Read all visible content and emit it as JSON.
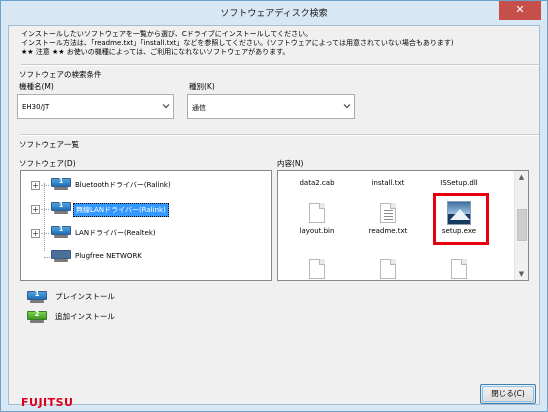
{
  "window": {
    "title": "ソフトウェアディスク検索",
    "close_glyph": "✕"
  },
  "instructions": [
    "インストールしたいソフトウェアを一覧から選び、Cドライブにインストールしてください。",
    "インストール方法は、「readme.txt」「install.txt」などを参照してください。(ソフトウェアによっては用意されていない場合もあります)",
    "★★ 注意 ★★ お使いの機種によっては、ご利用になれないソフトウェアがあります。"
  ],
  "search": {
    "section_label": "ソフトウェアの検索条件",
    "model_label": "機種名(M)",
    "model_value": "EH30/JT",
    "category_label": "種別(K)",
    "category_value": "通信"
  },
  "software_list": {
    "section_label": "ソフトウェア一覧",
    "software_label": "ソフトウェア(D)",
    "contents_label": "内容(N)",
    "items": [
      {
        "label": "Bluetoothドライバー(Ralink)",
        "num": "1",
        "selected": false
      },
      {
        "label": "無線LANドライバー(Ralink)",
        "num": "1",
        "selected": true
      },
      {
        "label": "LANドライバー(Realtek)",
        "num": "1",
        "selected": false
      },
      {
        "label": "Plugfree NETWORK",
        "num": "",
        "selected": false
      }
    ],
    "files": [
      {
        "label": "data2.cab",
        "icon": "cab-file-icon"
      },
      {
        "label": "install.txt",
        "icon": "text-file-icon"
      },
      {
        "label": "ISSetup.dll",
        "icon": "dll-file-icon"
      },
      {
        "label": "layout.bin",
        "icon": "bin-file-icon"
      },
      {
        "label": "readme.txt",
        "icon": "text-file-icon"
      },
      {
        "label": "setup.exe",
        "icon": "setup-exe-icon"
      }
    ]
  },
  "legend": [
    {
      "num": "1",
      "label": "プレインストール",
      "color": "#1e6fb8"
    },
    {
      "num": "2",
      "label": "追加インストール",
      "color": "#3f9a1f"
    }
  ],
  "footer": {
    "logo": "FUJITSU",
    "close_button": "閉じる(C)"
  },
  "colors": {
    "highlight": "#e8000f",
    "selection": "#3399ff",
    "logo": "#d8001c"
  }
}
